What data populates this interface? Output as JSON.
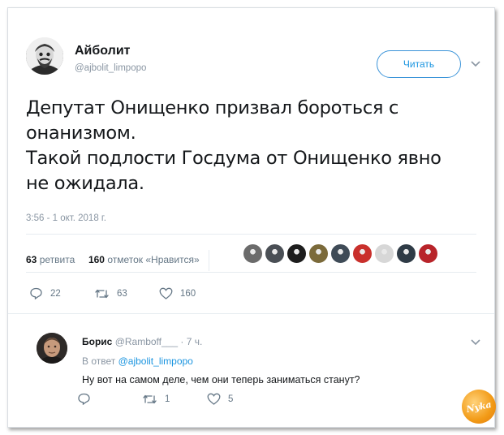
{
  "tweet": {
    "author_name": "Айболит",
    "author_handle": "@ajbolit_limpopo",
    "follow_label": "Читать",
    "text_lines": [
      "Депутат Онищенко призвал бороться с",
      "онанизмом.",
      "Такой подлости Госдума от Онищенко явно",
      "не ожидала."
    ],
    "timestamp": "3:56 - 1 окт. 2018 г.",
    "retweets_count": "63",
    "retweets_label": "ретвита",
    "likes_count": "160",
    "likes_label": "отметок «Нравится»",
    "actions": {
      "replies": "22",
      "retweets": "63",
      "likes": "160"
    },
    "liker_avatar_colors": [
      "#6b6b6b",
      "#4a4f55",
      "#1d1d1d",
      "#7b6a3a",
      "#3f4b57",
      "#c9302c",
      "#d7d7d7",
      "#2f3b46",
      "#b8242a"
    ]
  },
  "reply": {
    "author_name": "Борис",
    "author_handle": "@Ramboff___",
    "time": "· 7 ч.",
    "reply_to_prefix": "В ответ",
    "reply_to_handle": "@ajbolit_limpopo",
    "text": "Ну вот на самом деле, чем они теперь заниматься станут?",
    "actions": {
      "replies": "",
      "retweets": "1",
      "likes": "5"
    }
  },
  "watermark_text": "Nyka",
  "colors": {
    "accent": "#1b95e0",
    "muted": "#8a96a3",
    "text": "#14171a",
    "divider": "#e6ecf0"
  }
}
